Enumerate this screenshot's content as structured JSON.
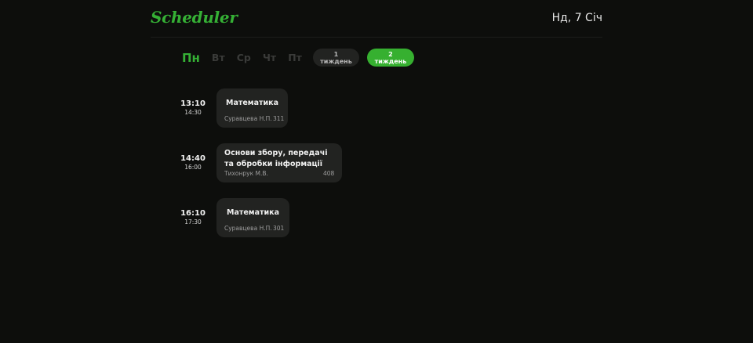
{
  "header": {
    "logo": "Scheduler",
    "date": "Нд, 7 Січ"
  },
  "days": [
    "Пн",
    "Вт",
    "Ср",
    "Чт",
    "Пт"
  ],
  "active_day": "Пн",
  "weeks": {
    "week1_label": "1 тиждень",
    "week2_label": "2 тиждень",
    "active": "2 тиждень"
  },
  "colors": {
    "accent": "#35b035",
    "background": "#0d0e0c",
    "card": "#222321"
  },
  "lessons": [
    {
      "start": "13:10",
      "end": "14:30",
      "title": "Математика",
      "teacher": "Суравцева Н.П.",
      "room": "311"
    },
    {
      "start": "14:40",
      "end": "16:00",
      "title": "Основи збору, передачі та обробки інформації",
      "teacher": "Тихонрук М.В.",
      "room": "408"
    },
    {
      "start": "16:10",
      "end": "17:30",
      "title": "Математика",
      "teacher": "Суравцева Н.П.",
      "room": "301"
    }
  ]
}
